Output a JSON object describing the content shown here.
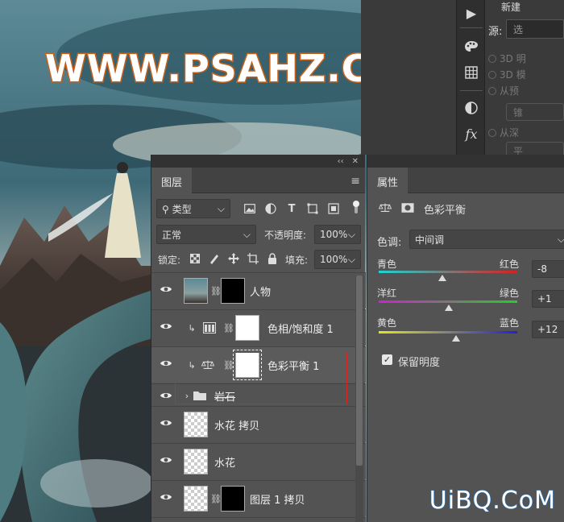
{
  "watermark_top": "WWW.PSAHZ.COM",
  "watermark_bottom": "UiBQ.CoM",
  "new_panel": {
    "title": "新建",
    "source_label": "源:",
    "source_value": "选",
    "options": [
      "3D 明",
      "3D 模",
      "从预",
      "从深"
    ],
    "pill_1": "锥",
    "pill_2": "平"
  },
  "tools": [
    "play-icon",
    "palette-icon",
    "grid-icon",
    "adjust-icon",
    "fx-icon"
  ],
  "tool_glyphs": {
    "play": "▶",
    "palette": "🎨",
    "grid": "▦",
    "adjust": "◑",
    "fx": "fx"
  },
  "layers_panel": {
    "collapse": "‹‹",
    "tab_label": "图层",
    "filter_label": "类型",
    "blend_mode": "正常",
    "opacity_label": "不透明度:",
    "opacity_value": "100%",
    "lock_label": "锁定:",
    "fill_label": "填充:",
    "fill_value": "100%",
    "layers": [
      {
        "name": "人物"
      },
      {
        "name": "色相/饱和度 1"
      },
      {
        "name": "色彩平衡 1"
      },
      {
        "name": "岩石"
      },
      {
        "name": "水花 拷贝"
      },
      {
        "name": "水花"
      },
      {
        "name": "图层 1 拷贝"
      }
    ]
  },
  "properties_panel": {
    "tab_label": "属性",
    "title": "色彩平衡",
    "tone_label": "色调:",
    "tone_value": "中间调",
    "sliders": [
      {
        "left": "青色",
        "right": "红色",
        "value": "-8",
        "level": -8
      },
      {
        "left": "洋红",
        "right": "绿色",
        "value": "+1",
        "level": 1
      },
      {
        "left": "黄色",
        "right": "蓝色",
        "value": "+12",
        "level": 12
      }
    ],
    "preserve_label": "保留明度",
    "preserve_checked": true
  },
  "colors": {
    "highlight_box": "#dd2222",
    "watermark_stroke": "#d2691e"
  }
}
